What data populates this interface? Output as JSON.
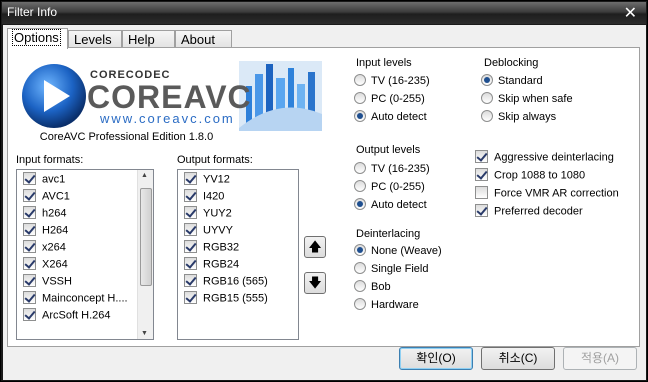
{
  "window": {
    "title": "Filter Info"
  },
  "tabs": [
    "Options",
    "Levels",
    "Help",
    "About"
  ],
  "logo": {
    "brand_top": "CORECODEC",
    "brand_main": "COREAVC",
    "url": "www.coreavc.com",
    "caption": "CoreAVC Professional Edition 1.8.0"
  },
  "input_formats": {
    "label": "Input formats:",
    "items": [
      {
        "label": "avc1",
        "checked": true
      },
      {
        "label": "AVC1",
        "checked": true
      },
      {
        "label": "h264",
        "checked": true
      },
      {
        "label": "H264",
        "checked": true
      },
      {
        "label": "x264",
        "checked": true
      },
      {
        "label": "X264",
        "checked": true
      },
      {
        "label": "VSSH",
        "checked": true
      },
      {
        "label": "Mainconcept H....",
        "checked": true
      },
      {
        "label": "ArcSoft H.264",
        "checked": true
      }
    ]
  },
  "output_formats": {
    "label": "Output formats:",
    "items": [
      {
        "label": "YV12",
        "checked": true
      },
      {
        "label": "I420",
        "checked": true
      },
      {
        "label": "YUY2",
        "checked": true
      },
      {
        "label": "UYVY",
        "checked": true
      },
      {
        "label": "RGB32",
        "checked": true
      },
      {
        "label": "RGB24",
        "checked": true
      },
      {
        "label": "RGB16 (565)",
        "checked": true
      },
      {
        "label": "RGB15 (555)",
        "checked": true
      }
    ]
  },
  "input_levels": {
    "label": "Input levels",
    "options": [
      "TV (16-235)",
      "PC (0-255)",
      "Auto detect"
    ],
    "selected": 2
  },
  "output_levels": {
    "label": "Output levels",
    "options": [
      "TV (16-235)",
      "PC (0-255)",
      "Auto detect"
    ],
    "selected": 2
  },
  "deinterlacing": {
    "label": "Deinterlacing",
    "options": [
      "None (Weave)",
      "Single Field",
      "Bob",
      "Hardware"
    ],
    "selected": 0
  },
  "deblocking": {
    "label": "Deblocking",
    "options": [
      "Standard",
      "Skip when safe",
      "Skip always"
    ],
    "selected": 0
  },
  "flags": [
    {
      "label": "Aggressive deinterlacing",
      "checked": true
    },
    {
      "label": "Crop 1088 to 1080",
      "checked": true
    },
    {
      "label": "Force VMR AR correction",
      "checked": false
    },
    {
      "label": "Preferred decoder",
      "checked": true
    }
  ],
  "buttons": {
    "ok": "확인(O)",
    "cancel": "취소(C)",
    "apply": "적용(A)"
  },
  "colors": {
    "title_bar": "#2c2c2c",
    "logo_blue": "#2b6cc4",
    "radio_dot": "#1f4f8f"
  }
}
